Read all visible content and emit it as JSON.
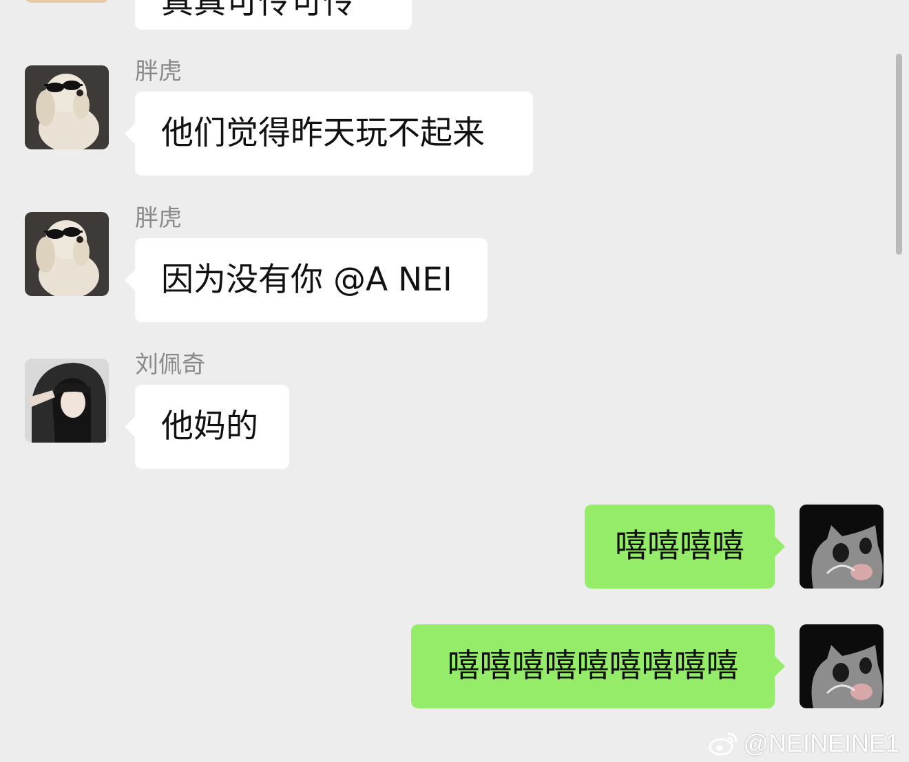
{
  "messages": [
    {
      "type": "incoming",
      "sender": "",
      "text": "真真可怜可怜",
      "avatar": "avatar-partial"
    },
    {
      "type": "incoming",
      "sender": "胖虎",
      "text": "他们觉得昨天玩不起来",
      "avatar": "dog-sunglasses-avatar"
    },
    {
      "type": "incoming",
      "sender": "胖虎",
      "text": "因为没有你 @A NEI",
      "avatar": "dog-sunglasses-avatar"
    },
    {
      "type": "incoming",
      "sender": "刘佩奇",
      "text": "他妈的",
      "avatar": "girl-hood-avatar"
    },
    {
      "type": "outgoing",
      "text": "嘻嘻嘻嘻",
      "avatar": "cat-meme-avatar"
    },
    {
      "type": "outgoing",
      "text": "嘻嘻嘻嘻嘻嘻嘻嘻嘻",
      "avatar": "cat-meme-avatar"
    }
  ],
  "watermark": {
    "text": "@NEINEINE1",
    "icon": "weibo-icon"
  },
  "colors": {
    "background": "#ededed",
    "incoming_bubble": "#ffffff",
    "outgoing_bubble": "#95ec69",
    "sender_name": "#8a8a8a"
  }
}
